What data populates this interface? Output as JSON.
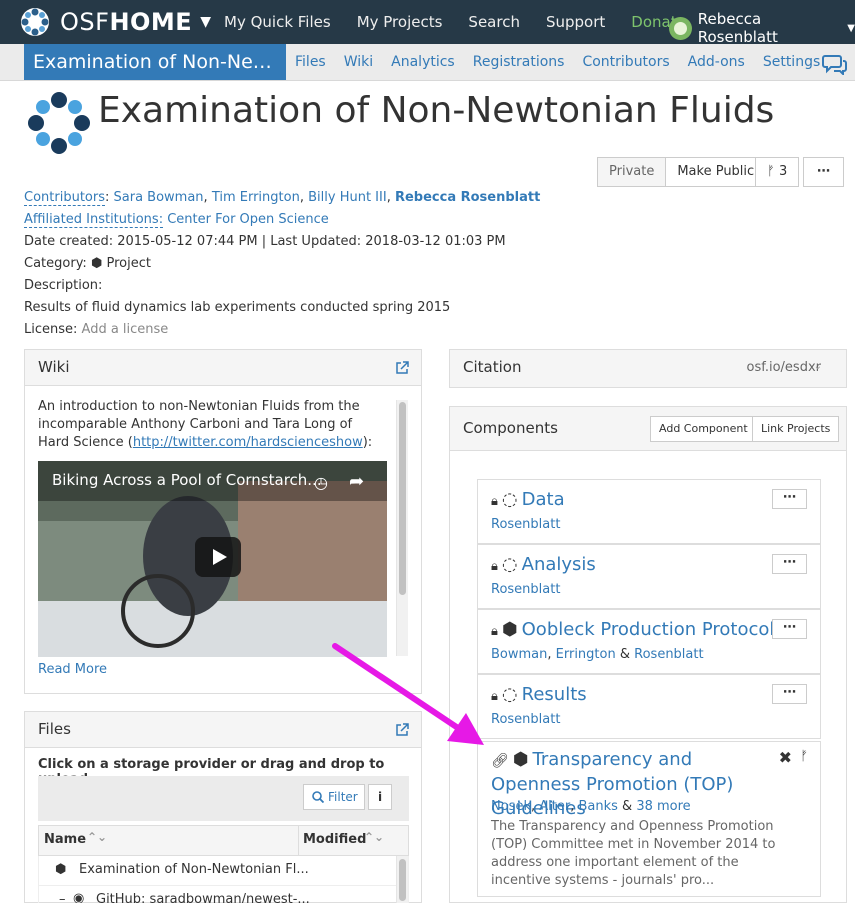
{
  "topnav": {
    "brand_prefix": "OSF",
    "brand_suffix": "HOME",
    "items": [
      "My Quick Files",
      "My Projects",
      "Search",
      "Support",
      "Donate"
    ],
    "user_name": "Rebecca Rosenblatt"
  },
  "projnav": {
    "title": "Examination of Non-Newtonian Fluids",
    "links": [
      "Files",
      "Wiki",
      "Analytics",
      "Registrations",
      "Contributors",
      "Add-ons",
      "Settings"
    ]
  },
  "project": {
    "title": "Examination of Non-Newtonian Fluids",
    "buttons": {
      "private": "Private",
      "make_public": "Make Public",
      "forks": "3",
      "more": "⋯"
    },
    "contributors_label": "Contributors",
    "contributors": [
      "Sara Bowman",
      "Tim Errington",
      "Billy Hunt III",
      "Rebecca Rosenblatt"
    ],
    "affiliated_label": "Affiliated Institutions:",
    "affiliated_value": "Center For Open Science",
    "dates": "Date created: 2015-05-12 07:44 PM | Last Updated: 2018-03-12 01:03 PM",
    "category_label": "Category:",
    "category_value": "Project",
    "description_label": "Description:",
    "description": "Results of fluid dynamics lab experiments conducted spring 2015",
    "license_label": "License:",
    "license_value": "Add a license"
  },
  "wiki": {
    "title": "Wiki",
    "text_before": "An introduction to non-Newtonian Fluids from the incomparable Anthony Carboni and Tara Long of Hard Science (",
    "link": "http://twitter.com/hardscienceshow",
    "text_after": "):",
    "video_title": "Biking Across a Pool of Cornstarch...",
    "read_more": "Read More"
  },
  "files": {
    "title": "Files",
    "hint": "Click on a storage provider or drag and drop to upload",
    "filter": "Filter",
    "info": "i",
    "col_name": "Name",
    "col_modified": "Modified",
    "rows": [
      "Examination of Non-Newtonian Fl...",
      "GitHub: saradbowman/newest-..."
    ]
  },
  "citation": {
    "title": "Citation",
    "url": "osf.io/esdxr"
  },
  "components": {
    "title": "Components",
    "add_button": "Add Component",
    "link_button": "Link Projects",
    "items": [
      {
        "title": "Data",
        "contributors": "Rosenblatt"
      },
      {
        "title": "Analysis",
        "contributors": "Rosenblatt"
      },
      {
        "title": "Oobleck Production Protocol",
        "c1": "Bowman",
        "c2": "Errington",
        "amp": "&",
        "c3": "Rosenblatt"
      },
      {
        "title": "Results",
        "contributors": "Rosenblatt"
      },
      {
        "title": "Transparency and Openness Promotion (TOP) Guidelines",
        "c1": "Nosek",
        "c2": "Alter",
        "c3": "Banks",
        "amp": "&",
        "more": "38 more",
        "description": "The Transparency and Openness Promotion (TOP) Committee met in November 2014 to address one important element of the incentive systems - journals' pro..."
      }
    ]
  },
  "colors": {
    "nav_bg": "#263947",
    "accent": "#337ab7",
    "donate": "#7ec46d",
    "arrow": "#e619e6"
  }
}
